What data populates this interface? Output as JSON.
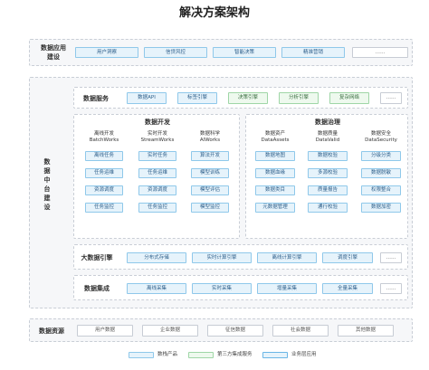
{
  "title": "解决方案架构",
  "app_layer": {
    "label_line1": "数据应用",
    "label_line2": "建设",
    "items": [
      "用户洞察",
      "信贷风控",
      "智能决策",
      "精准营销",
      "……"
    ]
  },
  "platform_label": [
    "数",
    "据",
    "中",
    "台",
    "建",
    "设"
  ],
  "data_service": {
    "label": "数据服务",
    "items": [
      "数据API",
      "标签引擎",
      "决策引擎",
      "分析引擎",
      "复杂网络",
      "……"
    ]
  },
  "dev": {
    "title": "数据开发",
    "columns": [
      {
        "head1": "离线开发",
        "head2": "BatchWorks",
        "items": [
          "离线任务",
          "任务运维",
          "资源调度",
          "任务监控"
        ]
      },
      {
        "head1": "实时开发",
        "head2": "StreamWorks",
        "items": [
          "实时任务",
          "任务运维",
          "资源调度",
          "任务监控"
        ]
      },
      {
        "head1": "数据科学",
        "head2": "AIWorks",
        "items": [
          "算法开发",
          "模型训练",
          "模型评估",
          "模型监控"
        ]
      }
    ]
  },
  "gov": {
    "title": "数据治理",
    "columns": [
      {
        "head1": "数据资产",
        "head2": "DataAssets",
        "items": [
          "数据地图",
          "数据血缘",
          "数据类目",
          "元数据管理"
        ]
      },
      {
        "head1": "数据质量",
        "head2": "DataValid",
        "items": [
          "数据校验",
          "多源校验",
          "质量报告",
          "通行校验"
        ]
      },
      {
        "head1": "数据安全",
        "head2": "DataSecurity",
        "items": [
          "分级分类",
          "数据脱敏",
          "权限整合",
          "数据加密"
        ]
      }
    ]
  },
  "engine": {
    "label": "大数据引擎",
    "items": [
      "分布式存储",
      "实时计算引擎",
      "离线计算引擎",
      "调度引擎",
      "……"
    ]
  },
  "integration": {
    "label": "数据集成",
    "items": [
      "离线采集",
      "实时采集",
      "增量采集",
      "全量采集",
      "……"
    ]
  },
  "resources": {
    "label": "数据资源",
    "items": [
      "用户数据",
      "企业数据",
      "征信数据",
      "社会数据",
      "其他数据"
    ]
  },
  "legend": [
    {
      "label": "数栈产品",
      "color": "#e6f3fb"
    },
    {
      "label": "第三方集成服务",
      "color": "#eef9ee"
    },
    {
      "label": "业务层应用",
      "color": "#e6f3fb"
    }
  ]
}
